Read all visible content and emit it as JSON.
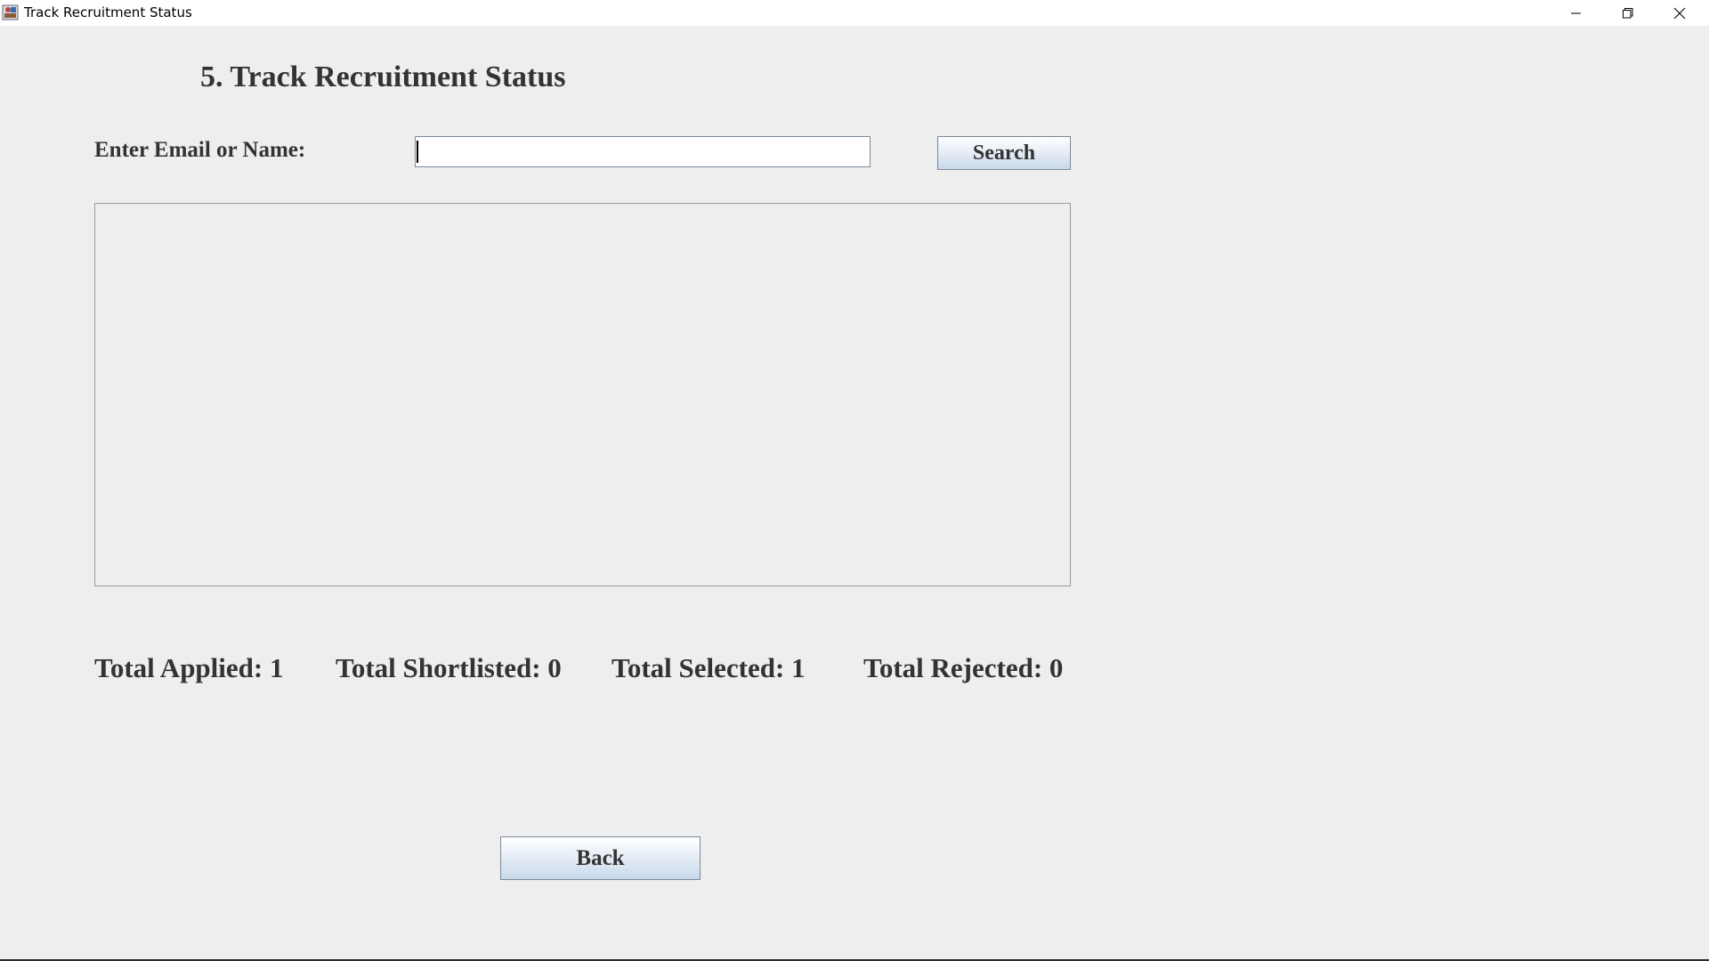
{
  "window": {
    "title": "Track Recruitment Status",
    "app_icon": "java-app-icon",
    "controls": {
      "minimize_icon": "minimize-icon",
      "maximize_icon": "restore-icon",
      "close_icon": "close-icon"
    }
  },
  "main": {
    "heading": "5. Track Recruitment Status",
    "search": {
      "label": "Enter Email or Name:",
      "value": "",
      "button_label": "Search"
    },
    "results": {
      "text": ""
    },
    "stats": {
      "applied": "Total Applied: 1",
      "shortlisted": "Total Shortlisted: 0",
      "selected": "Total Selected: 1",
      "rejected": "Total Rejected: 0"
    },
    "back_label": "Back"
  },
  "colors": {
    "background": "#eeeeee",
    "text": "#333333",
    "button_gradient_top": "#ffffff",
    "button_gradient_bottom": "#c9d9ea",
    "border": "#7a8a99"
  }
}
